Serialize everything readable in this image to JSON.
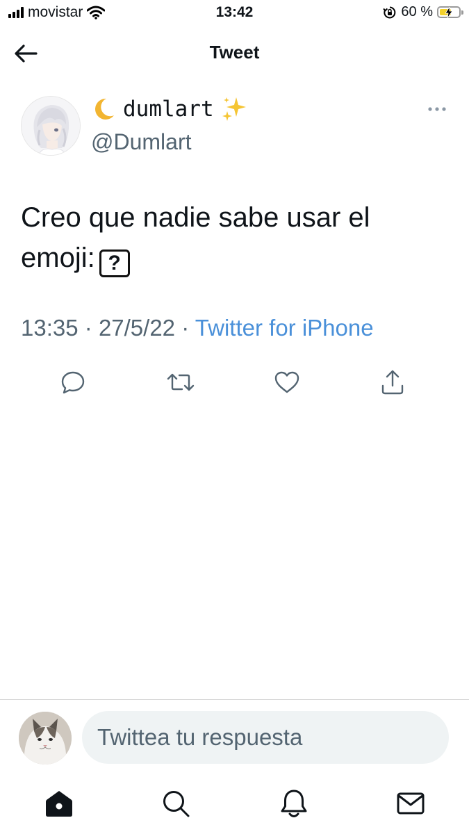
{
  "status_bar": {
    "carrier": "movistar",
    "time": "13:42",
    "battery_percent": "60 %",
    "battery_level": 0.6,
    "battery_color": "#f3d12c"
  },
  "header": {
    "title": "Tweet",
    "back_icon": "arrow-left-icon"
  },
  "tweet": {
    "author": {
      "display_name": "dumlart",
      "name_prefix_emoji": "crescent-moon",
      "name_suffix_emoji": "sparkles",
      "handle": "@Dumlart",
      "avatar": "anime-girl-white-hair-avatar"
    },
    "more_icon": "ellipsis-icon",
    "text": "Creo que nadie sabe usar el emoji:",
    "emoji_box": "?",
    "time": "13:35",
    "date": "27/5/22",
    "separator": "·",
    "source": "Twitter for iPhone",
    "source_color": "#4a90d9",
    "actions": [
      {
        "name": "reply",
        "icon": "comment-icon"
      },
      {
        "name": "retweet",
        "icon": "retweet-icon"
      },
      {
        "name": "like",
        "icon": "heart-icon"
      },
      {
        "name": "share",
        "icon": "share-icon"
      }
    ]
  },
  "reply": {
    "avatar": "cat-avatar",
    "placeholder": "Twittea tu respuesta"
  },
  "tab_bar": {
    "items": [
      {
        "name": "home",
        "icon": "home-icon",
        "active": true
      },
      {
        "name": "search",
        "icon": "search-icon"
      },
      {
        "name": "notifications",
        "icon": "bell-icon"
      },
      {
        "name": "messages",
        "icon": "mail-icon"
      }
    ]
  }
}
